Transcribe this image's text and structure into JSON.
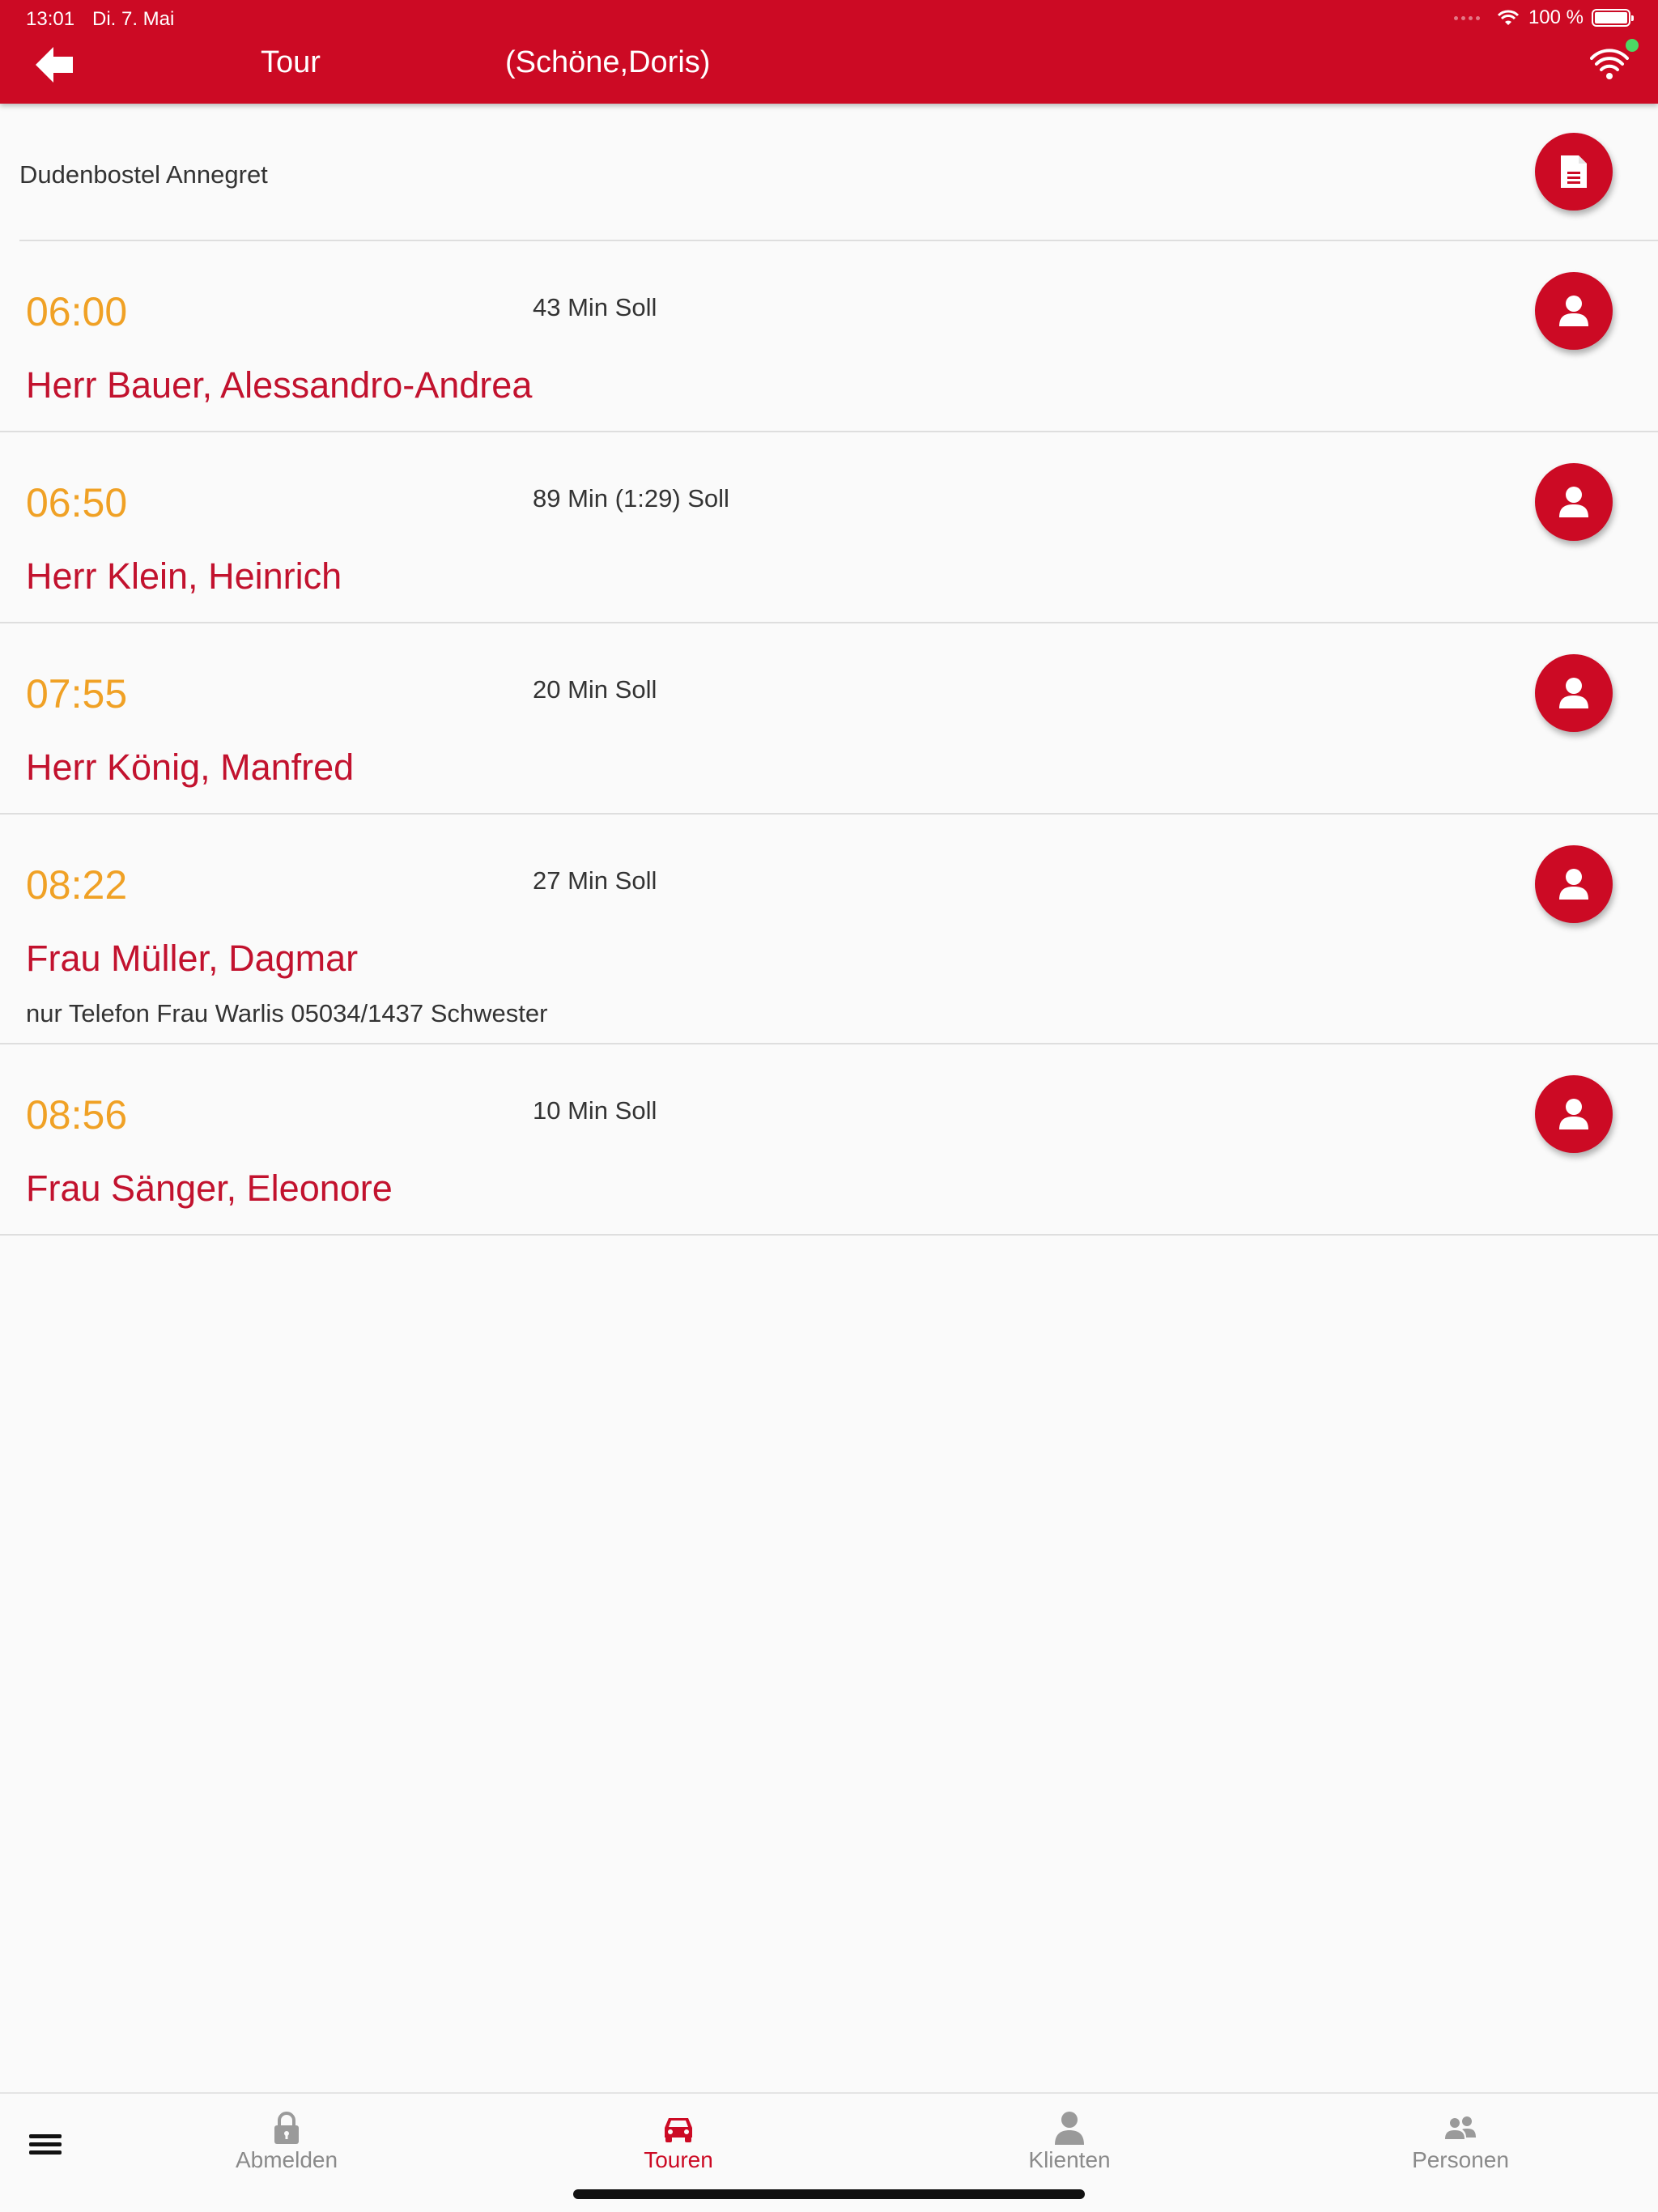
{
  "status_bar": {
    "time": "13:01",
    "date": "Di. 7. Mai",
    "battery": "100 %"
  },
  "header": {
    "title": "Tour",
    "subtitle": "(Schöne,Doris)",
    "back_icon": "arrow-left-icon",
    "connection_icon": "wifi-icon"
  },
  "section": {
    "label": "Dudenbostel Annegret",
    "action_icon": "document-icon"
  },
  "tour_items": [
    {
      "time": "06:00",
      "duration": "43 Min Soll",
      "client": "Herr Bauer, Alessandro-Andrea",
      "note": ""
    },
    {
      "time": "06:50",
      "duration": "89 Min (1:29) Soll",
      "client": "Herr Klein, Heinrich",
      "note": ""
    },
    {
      "time": "07:55",
      "duration": "20 Min Soll",
      "client": "Herr König, Manfred",
      "note": ""
    },
    {
      "time": "08:22",
      "duration": "27 Min Soll",
      "client": "Frau Müller, Dagmar",
      "note": "nur Telefon Frau Warlis 05034/1437 Schwester"
    },
    {
      "time": "08:56",
      "duration": "10 Min Soll",
      "client": "Frau Sänger, Eleonore",
      "note": ""
    }
  ],
  "tabbar": {
    "menu_icon": "hamburger-icon",
    "tabs": [
      {
        "label": "Abmelden",
        "icon": "lock-icon",
        "active": false
      },
      {
        "label": "Touren",
        "icon": "car-icon",
        "active": true
      },
      {
        "label": "Klienten",
        "icon": "person-icon",
        "active": false
      },
      {
        "label": "Personen",
        "icon": "people-icon",
        "active": false
      }
    ]
  },
  "colors": {
    "brand_red": "#cc0a24",
    "client_red": "#c2122e",
    "time_orange": "#f0a125",
    "tab_inactive": "#8a8a8a"
  }
}
